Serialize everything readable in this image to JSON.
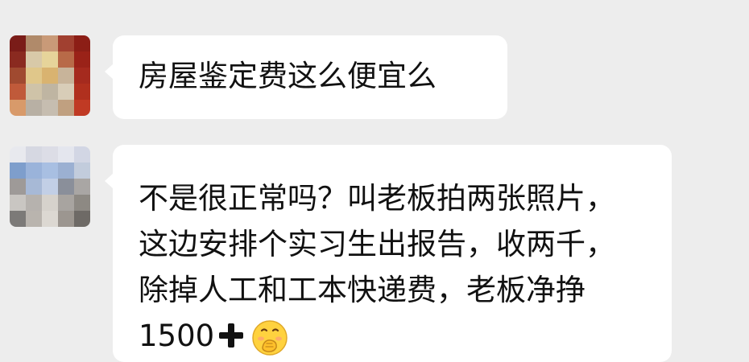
{
  "chat": {
    "messages": [
      {
        "sender": "contact-1",
        "avatar": {
          "style": "pixelated",
          "icon": "avatar-icon"
        },
        "text": "房屋鉴定费这么便宜么"
      },
      {
        "sender": "contact-2",
        "avatar": {
          "style": "pixelated",
          "icon": "avatar-icon"
        },
        "lines": [
          "不是很正常吗？叫老板拍两张照片，",
          "这边安排个实习生出报告，收两千，",
          "除掉人工和工本快递费，老板净挣",
          "1500"
        ],
        "trailing_icons": [
          "plus-icon",
          "cover-mouth-emoji-icon"
        ]
      }
    ]
  },
  "colors": {
    "background": "#ededed",
    "bubble": "#ffffff",
    "text": "#111111",
    "emoji_yellow": "#ffd23f"
  }
}
